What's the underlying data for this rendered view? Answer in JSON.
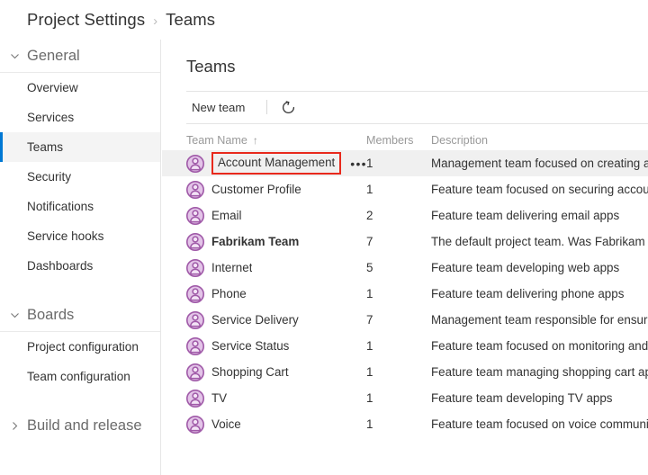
{
  "breadcrumb": {
    "root": "Project Settings",
    "separator": "›",
    "current": "Teams"
  },
  "sidebar": {
    "groups": [
      {
        "label": "General",
        "icon": "chevron-down-icon",
        "expanded": true,
        "items": [
          {
            "label": "Overview",
            "selected": false
          },
          {
            "label": "Services",
            "selected": false
          },
          {
            "label": "Teams",
            "selected": true
          },
          {
            "label": "Security",
            "selected": false
          },
          {
            "label": "Notifications",
            "selected": false
          },
          {
            "label": "Service hooks",
            "selected": false
          },
          {
            "label": "Dashboards",
            "selected": false
          }
        ]
      },
      {
        "label": "Boards",
        "icon": "chevron-down-icon",
        "expanded": true,
        "items": [
          {
            "label": "Project configuration",
            "selected": false
          },
          {
            "label": "Team configuration",
            "selected": false
          }
        ]
      },
      {
        "label": "Build and release",
        "icon": "chevron-right-icon",
        "expanded": false,
        "items": []
      }
    ]
  },
  "main": {
    "title": "Teams",
    "toolbar": {
      "new_team_label": "New team",
      "refresh_icon": "refresh-icon"
    },
    "table": {
      "columns": [
        {
          "key": "name",
          "label": "Team Name",
          "sorted": true,
          "sort_arrow": "↑"
        },
        {
          "key": "members",
          "label": "Members",
          "sorted": false,
          "sort_arrow": ""
        },
        {
          "key": "description",
          "label": "Description",
          "sorted": false,
          "sort_arrow": ""
        }
      ],
      "ellipsis_label": "•••",
      "rows": [
        {
          "name": "Account Management",
          "members": "1",
          "description": "Management team focused on creating an",
          "bold": false,
          "selected": true,
          "highlighted": true,
          "show_menu": true
        },
        {
          "name": "Customer Profile",
          "members": "1",
          "description": "Feature team focused on securing account",
          "bold": false,
          "selected": false,
          "highlighted": false,
          "show_menu": false
        },
        {
          "name": "Email",
          "members": "2",
          "description": "Feature team delivering email apps",
          "bold": false,
          "selected": false,
          "highlighted": false,
          "show_menu": false
        },
        {
          "name": "Fabrikam Team",
          "members": "7",
          "description": "The default project team. Was Fabrikam Fi",
          "bold": true,
          "selected": false,
          "highlighted": false,
          "show_menu": false
        },
        {
          "name": "Internet",
          "members": "5",
          "description": "Feature team developing web apps",
          "bold": false,
          "selected": false,
          "highlighted": false,
          "show_menu": false
        },
        {
          "name": "Phone",
          "members": "1",
          "description": "Feature team delivering phone apps",
          "bold": false,
          "selected": false,
          "highlighted": false,
          "show_menu": false
        },
        {
          "name": "Service Delivery",
          "members": "7",
          "description": "Management team responsible for ensure",
          "bold": false,
          "selected": false,
          "highlighted": false,
          "show_menu": false
        },
        {
          "name": "Service Status",
          "members": "1",
          "description": "Feature team focused on monitoring and ",
          "bold": false,
          "selected": false,
          "highlighted": false,
          "show_menu": false
        },
        {
          "name": "Shopping Cart",
          "members": "1",
          "description": "Feature team managing shopping cart app",
          "bold": false,
          "selected": false,
          "highlighted": false,
          "show_menu": false
        },
        {
          "name": "TV",
          "members": "1",
          "description": "Feature team developing TV apps",
          "bold": false,
          "selected": false,
          "highlighted": false,
          "show_menu": false
        },
        {
          "name": "Voice",
          "members": "1",
          "description": "Feature team focused on voice communic",
          "bold": false,
          "selected": false,
          "highlighted": false,
          "show_menu": false
        }
      ]
    }
  },
  "colors": {
    "accent": "#0078d4",
    "highlight_box": "#e8291c",
    "avatar_ring": "#a05aa8",
    "avatar_fill": "#e3c4e8",
    "selected_row": "#f0f0f0",
    "selected_nav": "#f4f4f4",
    "muted_text": "#999999"
  }
}
